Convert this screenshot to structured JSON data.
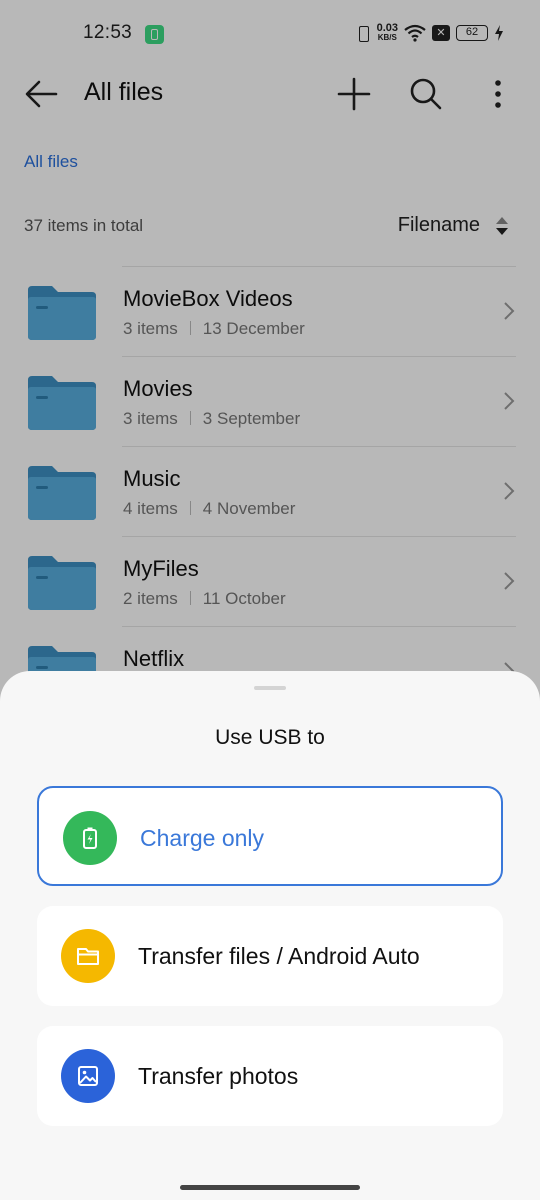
{
  "status_bar": {
    "time": "12:53",
    "net_speed_value": "0.03",
    "net_speed_unit": "KB/S",
    "battery_level": "62"
  },
  "app_bar": {
    "title": "All files"
  },
  "breadcrumb": "All files",
  "summary": {
    "items_total": "37 items in total",
    "sort_label": "Filename"
  },
  "files": [
    {
      "name": "MovieBox Videos",
      "count": "3 items",
      "date": "13 December"
    },
    {
      "name": "Movies",
      "count": "3 items",
      "date": "3 September"
    },
    {
      "name": "Music",
      "count": "4 items",
      "date": "4 November"
    },
    {
      "name": "MyFiles",
      "count": "2 items",
      "date": "11 October"
    },
    {
      "name": "Netflix",
      "count": "",
      "date": ""
    }
  ],
  "usb_sheet": {
    "title": "Use USB to",
    "options": [
      {
        "label": "Charge only",
        "selected": true,
        "icon": "battery-charging-icon",
        "color": "#2db84d"
      },
      {
        "label": "Transfer files / Android Auto",
        "selected": false,
        "icon": "folder-icon",
        "color": "#f5b800"
      },
      {
        "label": "Transfer photos",
        "selected": false,
        "icon": "image-icon",
        "color": "#2b63d9"
      }
    ]
  },
  "colors": {
    "folder": "#4a9fd0",
    "accent": "#3a78d9"
  }
}
